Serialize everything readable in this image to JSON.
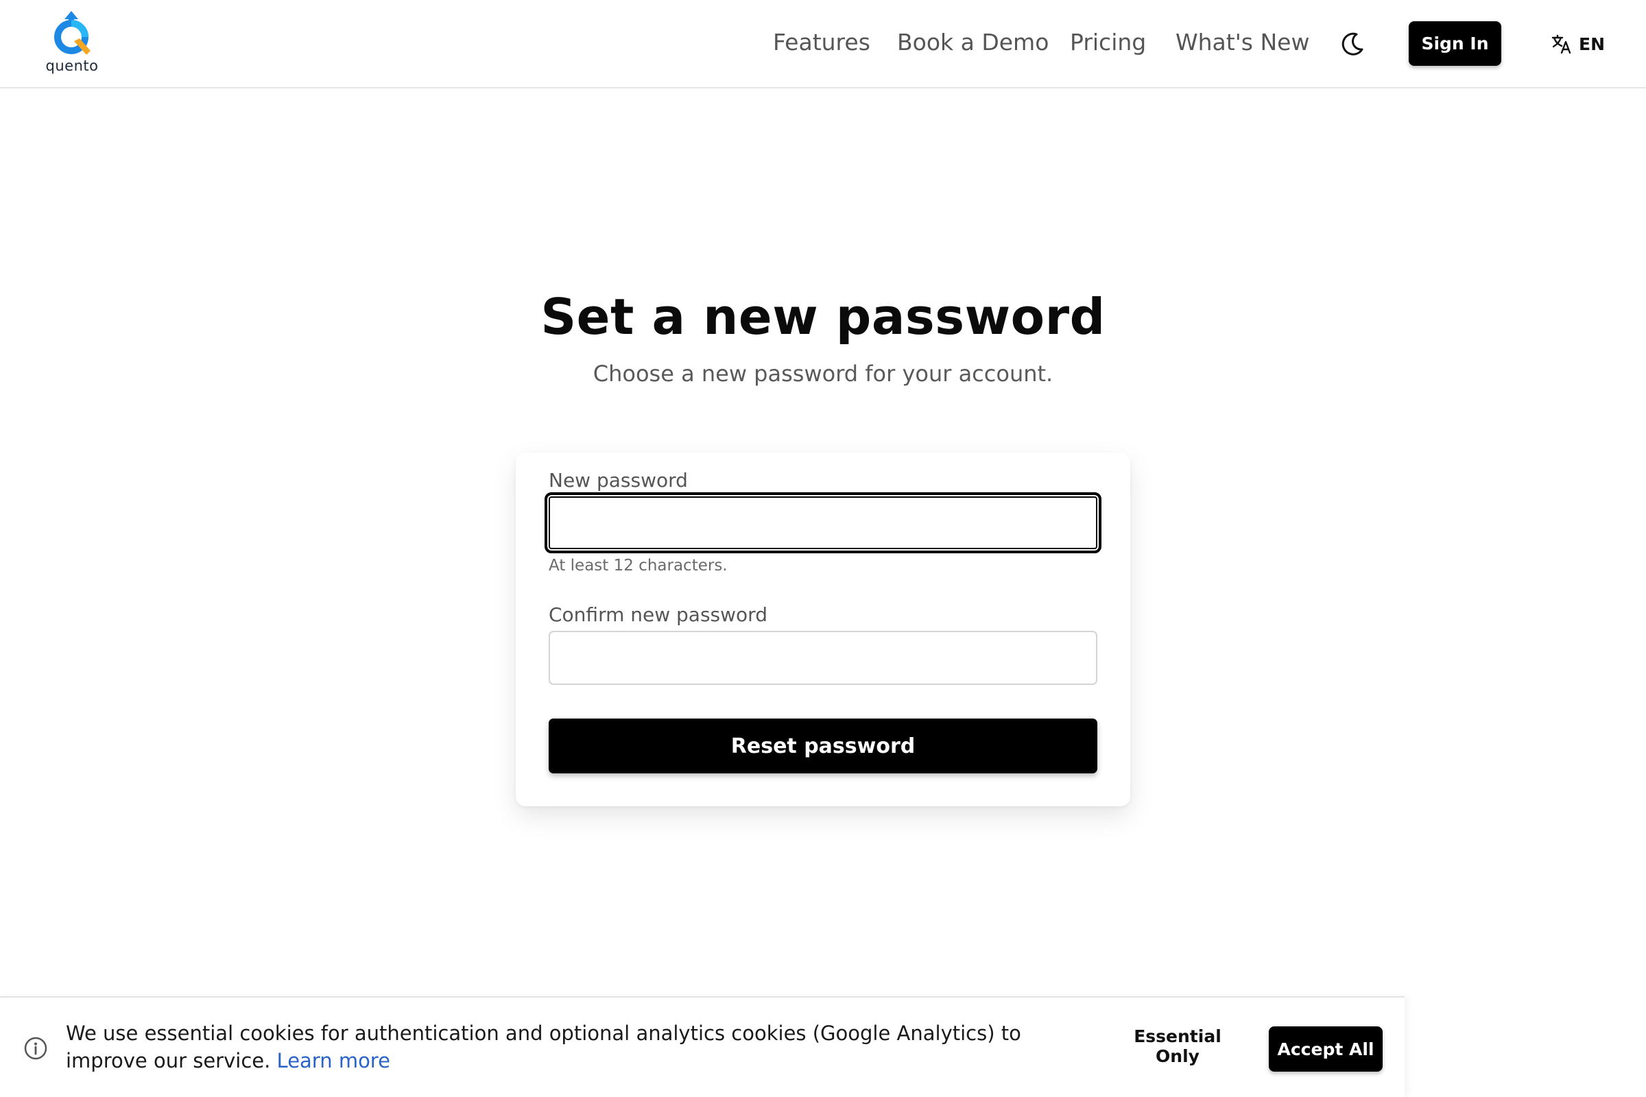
{
  "header": {
    "logo_text": "quento",
    "nav": [
      {
        "label": "Features"
      },
      {
        "label": "Book a Demo"
      },
      {
        "label": "Pricing"
      },
      {
        "label": "What's New"
      }
    ],
    "theme_icon": "moon-icon",
    "sign_in_label": "Sign In",
    "language_icon": "translate-icon",
    "language_label": "EN"
  },
  "main": {
    "title": "Set a new password",
    "subtitle": "Choose a new password for your account.",
    "form": {
      "new_password_label": "New password",
      "new_password_value": "",
      "new_password_hint": "At least 12 characters.",
      "confirm_password_label": "Confirm new password",
      "confirm_password_value": "",
      "submit_label": "Reset password"
    }
  },
  "cookie_banner": {
    "icon": "info-icon",
    "text": "We use essential cookies for authentication and optional analytics cookies (Google Analytics) to improve our service.",
    "learn_more_label": "Learn more",
    "essential_only_label": "Essential Only",
    "accept_all_label": "Accept All"
  },
  "colors": {
    "primary_button": "#000000",
    "link": "#2a63c8",
    "logo_blue": "#1e88e5",
    "logo_orange": "#f5a623"
  }
}
